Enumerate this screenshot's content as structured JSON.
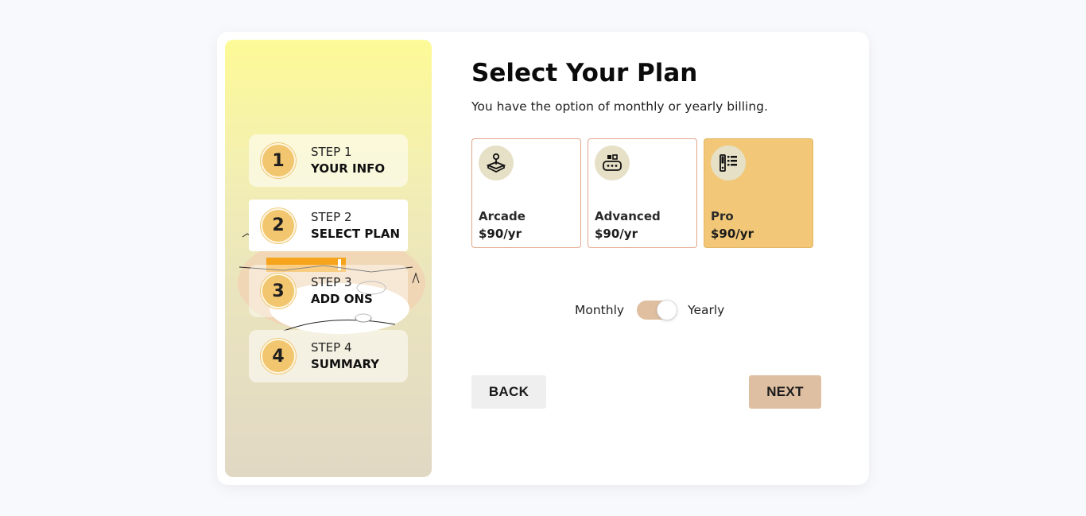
{
  "sidebar": {
    "steps": [
      {
        "number": "1",
        "label": "STEP 1",
        "title": "YOUR INFO"
      },
      {
        "number": "2",
        "label": "STEP 2",
        "title": "SELECT PLAN"
      },
      {
        "number": "3",
        "label": "STEP 3",
        "title": "ADD ONS"
      },
      {
        "number": "4",
        "label": "STEP 4",
        "title": "SUMMARY"
      }
    ],
    "active_step": 2
  },
  "main": {
    "title": "Select Your Plan",
    "subtitle": "You have the option of monthly or yearly billing.",
    "plans": [
      {
        "name": "Arcade",
        "price": "$90/yr",
        "icon": "joystick-icon",
        "selected": false
      },
      {
        "name": "Advanced",
        "price": "$90/yr",
        "icon": "gamepad-icon",
        "selected": false
      },
      {
        "name": "Pro",
        "price": "$90/yr",
        "icon": "controller-list-icon",
        "selected": true
      }
    ],
    "billing": {
      "monthly_label": "Monthly",
      "yearly_label": "Yearly",
      "current": "Yearly"
    },
    "back_label": "BACK",
    "next_label": "NEXT"
  },
  "colors": {
    "accent": "#f2c878",
    "toggle": "#dfbf9f",
    "next_button": "#dfbfa2",
    "plan_border": "#e2a78a"
  }
}
